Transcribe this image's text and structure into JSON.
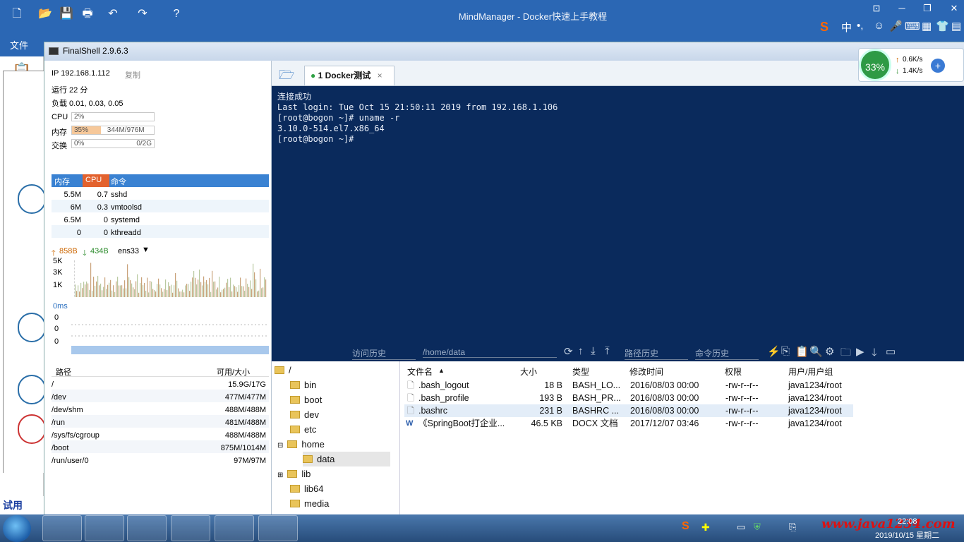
{
  "mindmanager": {
    "title": "MindManager - Docker快速上手教程",
    "file_tab": "文件",
    "paste_label": "粘贴",
    "trial_text": "试用"
  },
  "finalshell": {
    "title": "FinalShell 2.9.6.3",
    "ip_label": "IP 192.168.1.112",
    "copy_label": "复制",
    "uptime": "运行 22 分",
    "load": "负载 0.01, 0.03, 0.05",
    "cpu_label": "CPU",
    "cpu_value": "2%",
    "mem_label": "内存",
    "mem_percent": "35%",
    "mem_value": "344M/976M",
    "swap_label": "交换",
    "swap_percent": "0%",
    "swap_value": "0/2G",
    "proc_headers": [
      "内存",
      "CPU",
      "命令"
    ],
    "processes": [
      {
        "mem": "5.5M",
        "cpu": "0.7",
        "cmd": "sshd"
      },
      {
        "mem": "6M",
        "cpu": "0.3",
        "cmd": "vmtoolsd"
      },
      {
        "mem": "6.5M",
        "cpu": "0",
        "cmd": "systemd"
      },
      {
        "mem": "0",
        "cpu": "0",
        "cmd": "kthreadd"
      }
    ],
    "net_up": "858B",
    "net_down": "434B",
    "net_iface": "ens33",
    "net_ticks": [
      "5K",
      "3K",
      "1K"
    ],
    "ping_label": "0ms",
    "ping_ticks": [
      "0",
      "0",
      "0"
    ],
    "disk_headers": [
      "路径",
      "可用/大小"
    ],
    "disks": [
      {
        "path": "/",
        "size": "15.9G/17G"
      },
      {
        "path": "/dev",
        "size": "477M/477M"
      },
      {
        "path": "/dev/shm",
        "size": "488M/488M"
      },
      {
        "path": "/run",
        "size": "481M/488M"
      },
      {
        "path": "/sys/fs/cgroup",
        "size": "488M/488M"
      },
      {
        "path": "/boot",
        "size": "875M/1014M"
      },
      {
        "path": "/run/user/0",
        "size": "97M/97M"
      }
    ],
    "tab_label": "1 Docker测试",
    "terminal_lines": [
      "连接成功",
      "Last login: Tue Oct 15 21:50:11 2019 from 192.168.1.106",
      "[root@bogon ~]# uname -r",
      "3.10.0-514.el7.x86_64",
      "[root@bogon ~]#"
    ],
    "history_label": "访问历史",
    "path_value": "/home/data",
    "path_history_label": "路径历史",
    "cmd_history_label": "命令历史",
    "tree": [
      {
        "name": "/",
        "depth": 0
      },
      {
        "name": "bin",
        "depth": 1
      },
      {
        "name": "boot",
        "depth": 1
      },
      {
        "name": "dev",
        "depth": 1
      },
      {
        "name": "etc",
        "depth": 1
      },
      {
        "name": "home",
        "depth": 1
      },
      {
        "name": "data",
        "depth": 2
      },
      {
        "name": "lib",
        "depth": 1
      },
      {
        "name": "lib64",
        "depth": 1
      },
      {
        "name": "media",
        "depth": 1
      }
    ],
    "file_headers": [
      "文件名",
      "大小",
      "类型",
      "修改时间",
      "权限",
      "用户/用户组"
    ],
    "files": [
      {
        "name": ".bash_logout",
        "size": "18 B",
        "type": "BASH_LO...",
        "mtime": "2016/08/03 00:00",
        "perm": "-rw-r--r--",
        "owner": "java1234/root"
      },
      {
        "name": ".bash_profile",
        "size": "193 B",
        "type": "BASH_PR...",
        "mtime": "2016/08/03 00:00",
        "perm": "-rw-r--r--",
        "owner": "java1234/root"
      },
      {
        "name": ".bashrc",
        "size": "231 B",
        "type": "BASHRC ...",
        "mtime": "2016/08/03 00:00",
        "perm": "-rw-r--r--",
        "owner": "java1234/root"
      },
      {
        "name": "《SpringBoot打企业...",
        "size": "46.5 KB",
        "type": "DOCX 文档",
        "mtime": "2017/12/07 03:46",
        "perm": "-rw-r--r--",
        "owner": "java1234/root"
      }
    ]
  },
  "speed_widget": {
    "percent": "33%",
    "up": "0.6K/s",
    "down": "1.4K/s"
  },
  "taskbar": {
    "date": "2019/10/15 星期二",
    "time": "22:08",
    "watermark": "www.java1234.com"
  }
}
